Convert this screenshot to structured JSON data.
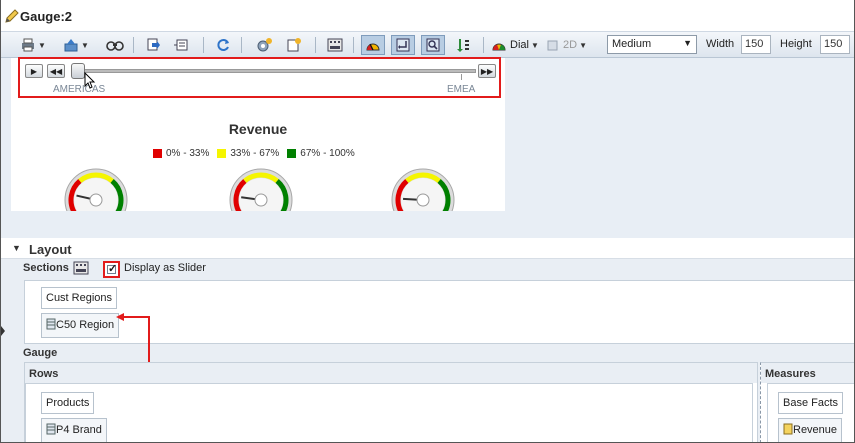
{
  "window": {
    "title": "Gauge:2"
  },
  "toolbar": {
    "gauge_type": "Dial",
    "dimension": "2D",
    "size": "Medium",
    "width_label": "Width",
    "width_value": "150",
    "height_label": "Height",
    "height_value": "150"
  },
  "slider": {
    "start_label": "AMERICAS",
    "end_label": "EMEA",
    "position": 0.0
  },
  "chart": {
    "title": "Revenue",
    "legend": [
      {
        "label": "0% - 33%",
        "color": "#e00000"
      },
      {
        "label": "33% - 67%",
        "color": "#f5f500"
      },
      {
        "label": "67% - 100%",
        "color": "#008000"
      }
    ],
    "gauges": [
      {
        "value": 0.18
      },
      {
        "value": 0.16
      },
      {
        "value": 0.14
      }
    ]
  },
  "layout": {
    "header": "Layout",
    "sections_label": "Sections",
    "display_as_slider_label": "Display as Slider",
    "display_as_slider_checked": true,
    "sections_items": [
      {
        "label": "Cust Regions",
        "kind": "header"
      },
      {
        "label": "C50 Region",
        "kind": "column"
      }
    ],
    "gauge_label": "Gauge",
    "rows": {
      "label": "Rows",
      "items": [
        {
          "label": "Products",
          "kind": "header"
        },
        {
          "label": "P4 Brand",
          "kind": "column"
        }
      ]
    },
    "measures": {
      "label": "Measures",
      "items": [
        {
          "label": "Base Facts",
          "kind": "header"
        },
        {
          "label": "Revenue",
          "kind": "measure"
        }
      ]
    }
  },
  "colors": {
    "highlight": "#e21b1b",
    "panel_bg": "#e9eef4",
    "toolbar_pressed": "#b8cde3"
  }
}
